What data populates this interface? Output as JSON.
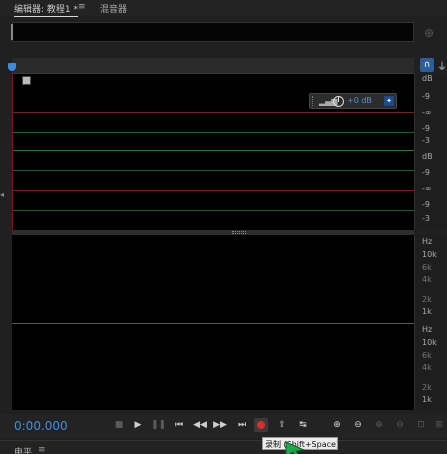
{
  "tabs": {
    "editor_label": "编辑器: 教程1 *",
    "menu_icon": "≡",
    "mixer_label": "混音器"
  },
  "waveform": {
    "hud_value": "+0 dB",
    "scale_top": [
      "dB",
      "-9",
      "-∞",
      "-9",
      "-3"
    ],
    "scale_bottom": [
      "dB",
      "-9",
      "-∞",
      "-9",
      "-3"
    ]
  },
  "spectral": {
    "scale_top": [
      "Hz",
      "10k",
      "6k",
      "4k",
      "2k",
      "1k"
    ],
    "scale_bottom": [
      "Hz",
      "10k",
      "6k",
      "4k",
      "2k",
      "1k"
    ]
  },
  "transport": {
    "time": "0:00.000"
  },
  "tooltip": {
    "text": "录制 (Shift+Space)"
  },
  "bottom_panel": {
    "label": "电平",
    "menu_icon": "≡"
  },
  "icons": {
    "stop": "stop-icon",
    "play": "play-icon",
    "pause": "pause-icon",
    "record": "record-icon"
  },
  "colors": {
    "accent": "#3f8fe6",
    "record": "#e12a2a",
    "red_line": "#7a1f1f",
    "green_line": "#1f5f2a"
  }
}
